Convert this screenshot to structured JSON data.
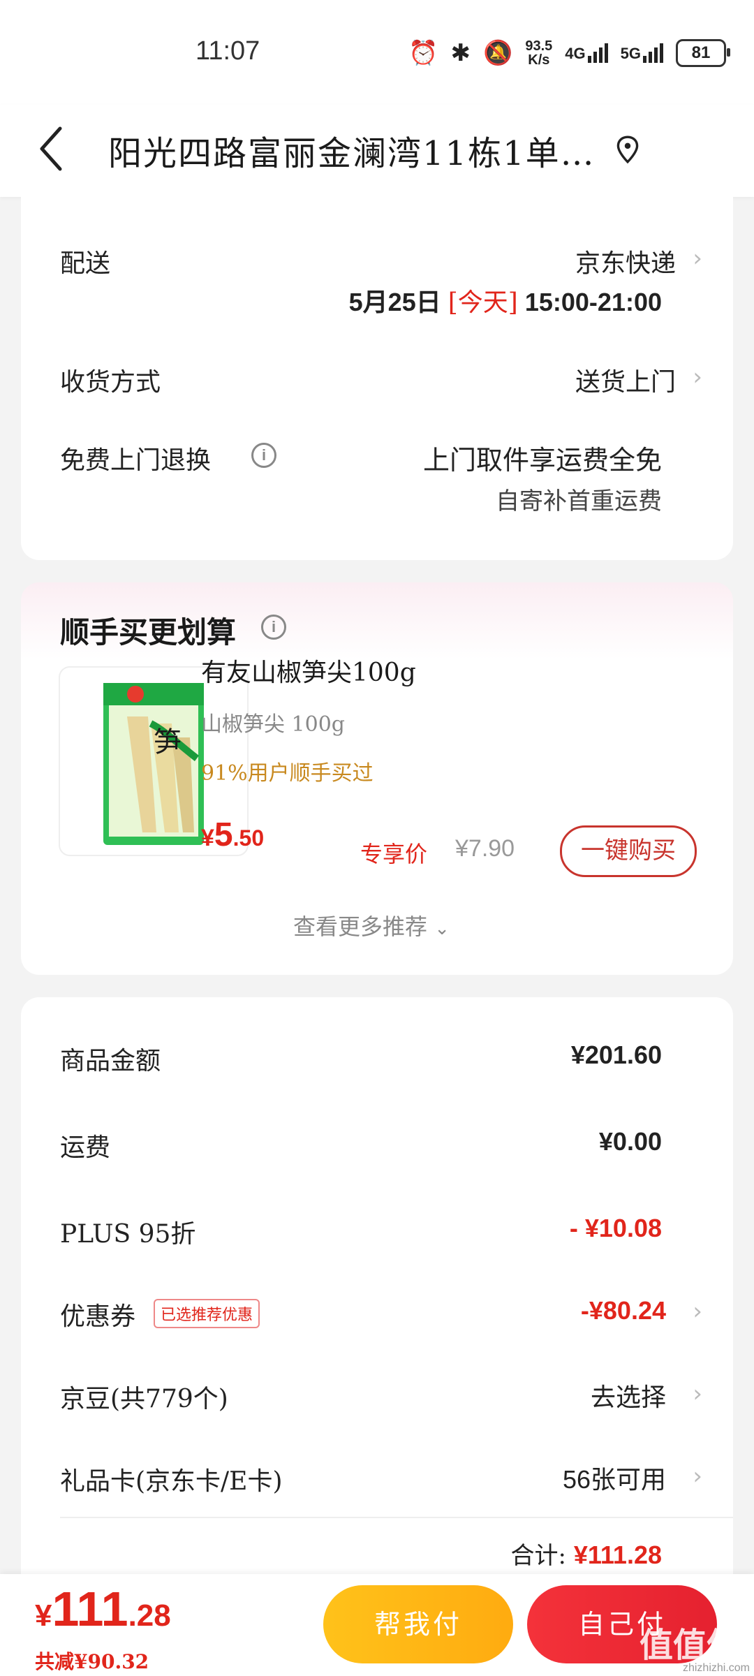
{
  "status_bar": {
    "time": "11:07",
    "speed_value": "93.5",
    "speed_unit": "K/s",
    "net1": "4G",
    "net2": "5G",
    "battery": "81"
  },
  "header": {
    "address": "阳光四路富丽金澜湾11栋1单…"
  },
  "delivery": {
    "label": "配送",
    "carrier": "京东快递",
    "date": "5月25日",
    "today": "[今天]",
    "time_window": "15:00-21:00",
    "receive_label": "收货方式",
    "receive_value": "送货上门",
    "return_label": "免费上门退换",
    "return_value": "上门取件享运费全免",
    "return_sub": "自寄补首重运费"
  },
  "recommend": {
    "title": "顺手买更划算",
    "product_name": "有友山椒笋尖100g",
    "product_spec": "山椒笋尖 100g",
    "social_proof": "91%用户顺手买过",
    "price_symbol": "¥",
    "price_int": "5",
    "price_dec": ".50",
    "price_tag": "专享价",
    "original_price": "¥7.90",
    "buy_label": "一键购买",
    "more_label": "查看更多推荐"
  },
  "summary": {
    "goods_label": "商品金额",
    "goods_value": "¥201.60",
    "shipping_label": "运费",
    "shipping_value": "¥0.00",
    "plus_label": "PLUS 95折",
    "plus_value": "- ¥10.08",
    "coupon_label": "优惠券",
    "coupon_badge": "已选推荐优惠",
    "coupon_value": "-¥80.24",
    "beans_label": "京豆(共779个)",
    "beans_value": "去选择",
    "giftcard_label": "礼品卡(京东卡/E卡)",
    "giftcard_value": "56张可用",
    "total_label": "合计:",
    "total_value": "¥111.28"
  },
  "bottom": {
    "currency": "¥",
    "total_int": "111",
    "total_dec": ".28",
    "saved": "共减¥90.32",
    "help_pay": "帮我付",
    "self_pay": "自己付",
    "watermark": "值值值",
    "watermark_sub": "zhizhizhi.com"
  }
}
